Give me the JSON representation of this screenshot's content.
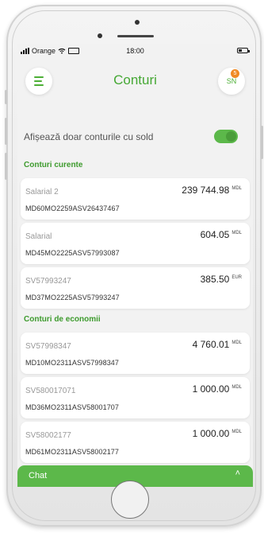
{
  "status_bar": {
    "carrier": "Orange",
    "time": "18:00"
  },
  "header": {
    "title": "Conturi",
    "avatar_initials": "SN",
    "notification_count": "5"
  },
  "filter": {
    "label": "Afișează doar conturile cu sold",
    "toggle_on": true
  },
  "sections": {
    "current": {
      "title": "Conturi curente",
      "accounts": [
        {
          "name": "Salarial 2",
          "amount": "239 744.98",
          "currency": "MDL",
          "iban": "MD60MO2259ASV26437467"
        },
        {
          "name": "Salarial",
          "amount": "604.05",
          "currency": "MDL",
          "iban": "MD45MO2225ASV57993087"
        },
        {
          "name": "SV57993247",
          "amount": "385.50",
          "currency": "EUR",
          "iban": "MD37MO2225ASV57993247"
        }
      ]
    },
    "savings": {
      "title": "Conturi de economii",
      "accounts": [
        {
          "name": "SV57998347",
          "amount": "4 760.01",
          "currency": "MDL",
          "iban": "MD10MO2311ASV57998347"
        },
        {
          "name": "SV580017071",
          "amount": "1 000.00",
          "currency": "MDL",
          "iban": "MD36MO2311ASV58001707"
        },
        {
          "name": "SV58002177",
          "amount": "1 000.00",
          "currency": "MDL",
          "iban": "MD61MO2311ASV58002177"
        }
      ]
    }
  },
  "chat": {
    "label": "Chat"
  },
  "colors": {
    "brand_green": "#5cb84a",
    "title_green": "#45a834",
    "badge_orange": "#f08a24"
  }
}
